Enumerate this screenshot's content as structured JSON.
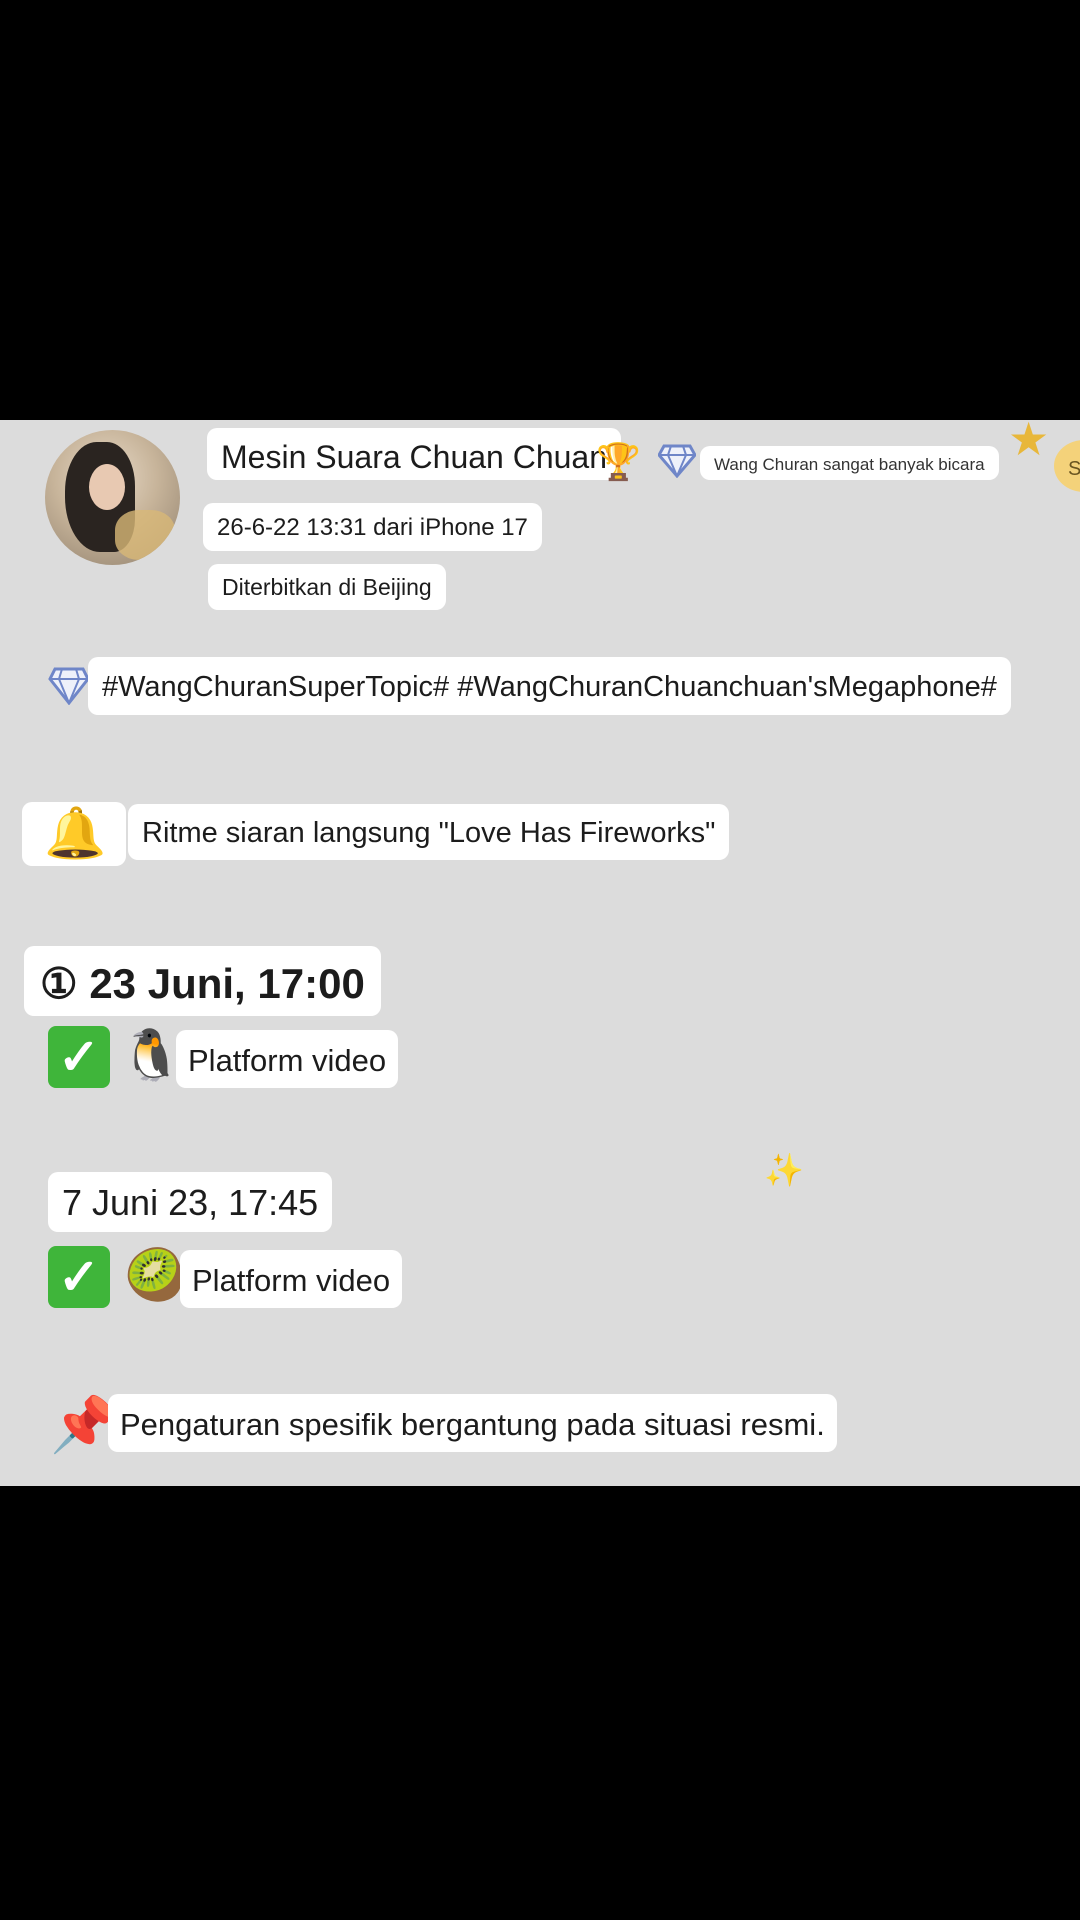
{
  "post": {
    "author_name": "Mesin Suara Chuan Chuan",
    "author_badge_text": "Wang Churan sangat banyak bicara",
    "timestamp_source": "26-6-22 13:31 dari iPhone 17",
    "location": "Diterbitkan di Beijing",
    "topics": "#WangChuranSuperTopic# #WangChuranChuanchuan'sMegaphone#",
    "corner_badge": "S"
  },
  "body": {
    "bell_emoji": "🔔",
    "headline": "Ritme siaran langsung \"Love Has Fireworks\"",
    "schedule": [
      {
        "time": "① 23 Juni, 17:00",
        "check": "✓",
        "platform_emoji": "🐧",
        "platform": "Platform video"
      },
      {
        "time": "7 Juni 23, 17:45",
        "check": "✓",
        "platform_emoji": "🥝",
        "platform": "Platform video"
      }
    ],
    "sparkle_emoji": "✨",
    "note_emoji": "📌",
    "note": "Pengaturan spesifik bergantung pada situasi resmi."
  },
  "colors": {
    "background": "#dcdcdc",
    "letterbox": "#000000",
    "check_green": "#3fb53a",
    "gem_blue": "#6f86c8"
  },
  "icons": {
    "gem": "diamond-icon",
    "bell": "bell-icon",
    "pushpin": "pushpin-icon",
    "penguin": "penguin-icon",
    "kiwi": "kiwi-icon",
    "check": "check-mark-icon",
    "sparkles": "sparkles-icon",
    "star": "star-icon"
  }
}
